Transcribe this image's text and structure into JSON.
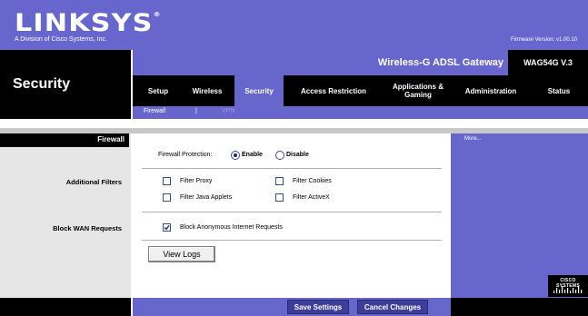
{
  "brand": {
    "logo_text": "LINKSYS",
    "logo_mark": "®",
    "subtitle": "A Division of Cisco Systems, Inc.",
    "firmware": "Firmware Version: v1.00.10",
    "product_name": "Wireless-G ADSL Gateway",
    "model": "WAG54G V.3"
  },
  "page_title": "Security",
  "tabs": [
    {
      "label": "Setup"
    },
    {
      "label": "Wireless"
    },
    {
      "label": "Security"
    },
    {
      "label": "Access Restriction"
    },
    {
      "label": "Applications & Gaming"
    },
    {
      "label": "Administration"
    },
    {
      "label": "Status"
    }
  ],
  "subtabs": {
    "firewall": "Firewall",
    "separator": "|",
    "vpn": "VPN"
  },
  "section_title": "Firewall",
  "labels": {
    "additional_filters": "Additional Filters",
    "block_wan": "Block WAN Requests"
  },
  "firewall_protection": {
    "label": "Firewall Protection:",
    "enable": "Enable",
    "disable": "Disable",
    "selected": "Enable"
  },
  "filters": {
    "proxy": "Filter Proxy",
    "cookies": "Filter Cookies",
    "java": "Filter Java Applets",
    "activex": "Filter ActiveX"
  },
  "block_anon": "Block Anonymous Internet Requests",
  "view_logs": "View Logs",
  "more": "More...",
  "cisco": "CISCO SYSTEMS",
  "footer": {
    "save": "Save Settings",
    "cancel": "Cancel Changes"
  },
  "colors": {
    "brand_blue": "#6666cc",
    "black": "#000000"
  }
}
